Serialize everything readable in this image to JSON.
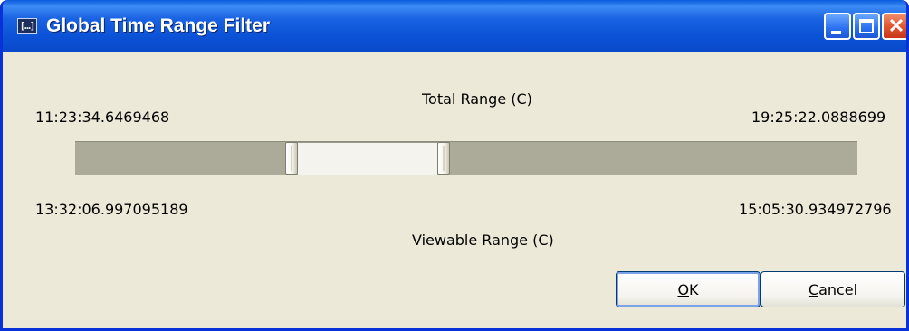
{
  "window": {
    "title": "Global Time Range Filter",
    "icon": "app-icon",
    "icon_glyph": "[…]"
  },
  "total_range": {
    "label": "Total Range (C)",
    "start": "11:23:34.6469468",
    "end": "19:25:22.0888699"
  },
  "viewable_range": {
    "label": "Viewable Range (C)",
    "start": "13:32:06.997095189",
    "end": "15:05:30.934972796"
  },
  "range_slider": {
    "selection_start_fraction": 0.268,
    "selection_end_fraction": 0.463
  },
  "buttons": {
    "ok": {
      "label": "OK",
      "mnemonic": "O",
      "rest": "K"
    },
    "cancel": {
      "label": "Cancel",
      "mnemonic": "C",
      "rest": "ancel"
    }
  },
  "colors": {
    "titlebar": "#0a5bdd",
    "dialog_bg": "#ece9d8",
    "track": "#acaa99",
    "selection": "#f4f3ee"
  }
}
